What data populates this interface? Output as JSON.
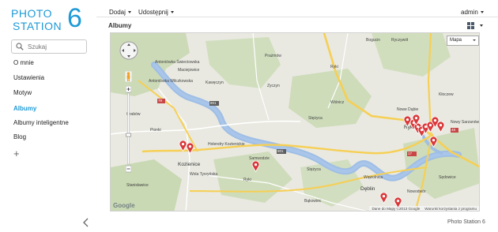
{
  "brand": {
    "line1": "PHOTO",
    "line2": "STATION",
    "number": "6"
  },
  "search": {
    "placeholder": "Szukaj"
  },
  "sidebar": {
    "items": [
      {
        "label": "O mnie",
        "active": false
      },
      {
        "label": "Ustawienia",
        "active": false
      },
      {
        "label": "Motyw",
        "active": false
      },
      {
        "label": "Albumy",
        "active": true
      },
      {
        "label": "Albumy inteligentne",
        "active": false
      },
      {
        "label": "Blog",
        "active": false
      }
    ],
    "add_label": "+"
  },
  "toolbar": {
    "add_label": "Dodaj",
    "share_label": "Udostępnij",
    "user_label": "admin"
  },
  "page": {
    "title": "Albumy"
  },
  "map": {
    "type_label": "Mapa",
    "google_logo": "Google",
    "attribution": "Dane do Mapy ©2013 Google",
    "terms": "Warunki korzystania z programu",
    "places": [
      {
        "name": "Maciejowice"
      },
      {
        "name": "Kawęczyn"
      },
      {
        "name": "Antoniówka Świerżowska"
      },
      {
        "name": "Antoniówka Wilczkowska"
      },
      {
        "name": "Prażmów"
      },
      {
        "name": "Grabów"
      },
      {
        "name": "Pionki"
      },
      {
        "name": "Zyczyn"
      },
      {
        "name": "Stężyca"
      },
      {
        "name": "Ryki"
      },
      {
        "name": "Wiśnicz"
      },
      {
        "name": "Nowe Dąbie"
      },
      {
        "name": "Bogucin"
      },
      {
        "name": "Ryki"
      },
      {
        "name": "Kozienice"
      },
      {
        "name": "Wola Tyrzyńska"
      },
      {
        "name": "Holendry Kozienickie"
      },
      {
        "name": "Samwodzie"
      },
      {
        "name": "Ryczywół"
      },
      {
        "name": "Stężyca"
      },
      {
        "name": "Dęblin"
      },
      {
        "name": "Ryki"
      },
      {
        "name": "Nowy Sarzanów"
      },
      {
        "name": "Sędowice"
      },
      {
        "name": "Stanisławice"
      },
      {
        "name": "Nowodwór"
      },
      {
        "name": "Kłoczew"
      },
      {
        "name": "Wąwolnica"
      },
      {
        "name": "Bąkowiec"
      }
    ],
    "road_labels": [
      "79",
      "48",
      "801",
      "801",
      "801",
      "17",
      "S17",
      "48"
    ],
    "pin_color": "#d9383a",
    "pin_count": 15
  },
  "footer": {
    "text": "Photo Station 6"
  },
  "colors": {
    "accent": "#1e9ad6",
    "river": "#9fbee5",
    "road_major": "#f6cf54",
    "forest": "#b9cfa0"
  }
}
